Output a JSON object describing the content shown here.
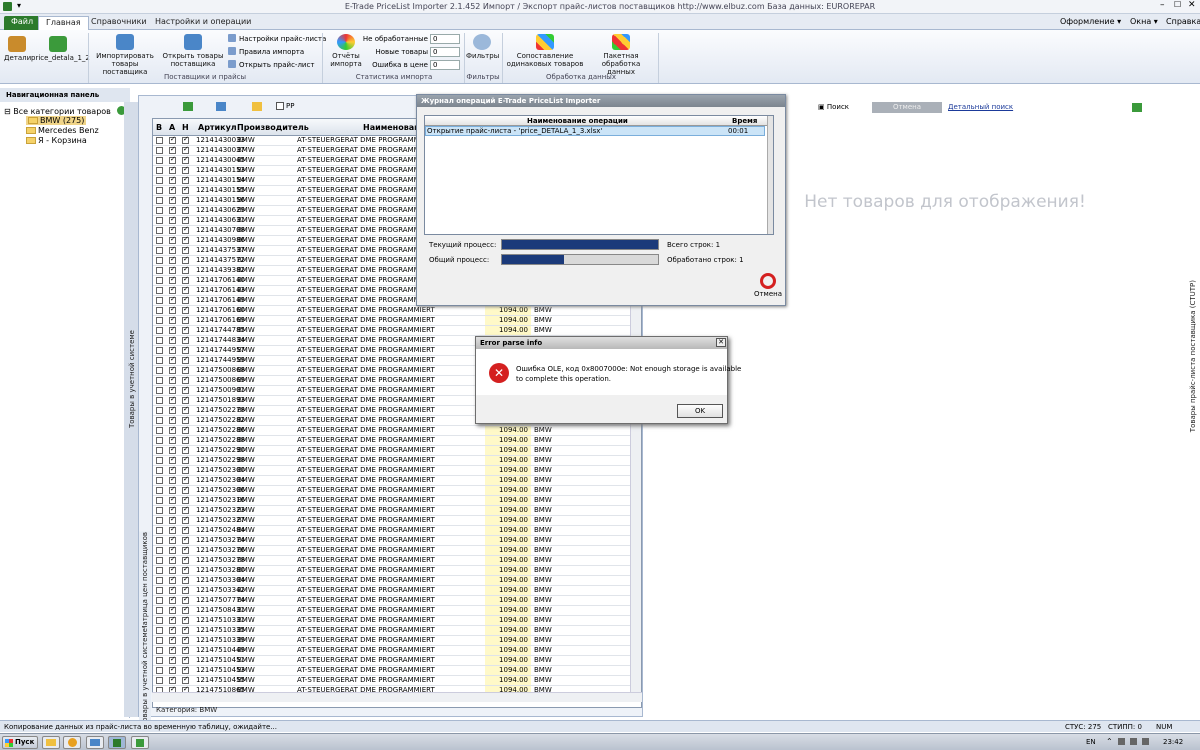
{
  "window": {
    "title": "E-Trade PriceList Importer 2.1.452     Импорт / Экспорт прайс-листов поставщиков     http://www.elbuz.com     База данных: EUROREPAR"
  },
  "tabs": {
    "file": "Файл",
    "main": "Главная",
    "refs": "Справочники",
    "settings": "Настройки и операции"
  },
  "top_right_menu": {
    "design": "Оформление",
    "windows": "Окна",
    "help": "Справка"
  },
  "ribbon": {
    "detail": "Детали",
    "price_detala": "price_detala_1_2",
    "import_goods": "Импортировать товары поставщика",
    "open_goods": "Открыть товары поставщика",
    "price_settings": "Настройки прайс-листа",
    "import_rules": "Правила импорта",
    "open_price": "Открыть прайс-лист",
    "group_suppliers": "Поставщики и прайсы",
    "import_reports": "Отчёты импорта",
    "stat_unprocessed_label": "Не обработанные",
    "stat_unprocessed_val": "0",
    "stat_new_label": "Новые товары",
    "stat_new_val": "0",
    "stat_error_label": "Ошибка в цене",
    "stat_error_val": "0",
    "group_stats": "Статистика импорта",
    "filters": "Фильтры",
    "group_filters": "Фильтры",
    "match_goods": "Сопоставление одинаковых товаров",
    "batch_processing": "Пакетная обработка данных",
    "group_processing": "Обработка данных"
  },
  "nav": {
    "title": "Навигационная панель",
    "all_categories": "Все категории товаров",
    "bmw": "BMW (275)",
    "mercedes": "Mercedes Benz",
    "cart": "Я - Корзина",
    "vertical_tab_accounting": "Товары в учетной системе",
    "vertical_tab_matrix": "Матрица цен поставщиков",
    "vertical_tab_goods": "Товары в учетной системе"
  },
  "grid": {
    "pp_label": "PP",
    "headers": [
      "В",
      "А",
      "Н",
      "Артикул",
      "Производитель",
      "Наименование"
    ],
    "name_value": "AT-STEUERGERAT DME PROGRAMMIERT",
    "manufacturer": "BMW",
    "price": "1094.00",
    "category_line": "Категория: BMW",
    "rows": [
      "12141430033",
      "12141430037",
      "12141430045",
      "12141430153",
      "12141430154",
      "12141430155",
      "12141430156",
      "12141430629",
      "12141430631",
      "12141430708",
      "12141430986",
      "12141437537",
      "12141437572",
      "12141439382",
      "12141706140",
      "12141706143",
      "12141706149",
      "12141706160",
      "12141706169",
      "12141744785",
      "12141744834",
      "12141744957",
      "12141744959",
      "12147500868",
      "12147500869",
      "12147500901",
      "12147501893",
      "12147502278",
      "12147502282",
      "12147502286",
      "12147502288",
      "12147502290",
      "12147502298",
      "12147502300",
      "12147502304",
      "12147502306",
      "12147502316",
      "12147502323",
      "12147502327",
      "12147502484",
      "12147503274",
      "12147503276",
      "12147503278",
      "12147503280",
      "12147503304",
      "12147503342",
      "12147507774",
      "12147508431",
      "12147510331",
      "12147510335",
      "12147510339",
      "12147510449",
      "12147510451",
      "12147510453",
      "12147510455",
      "12147510865"
    ]
  },
  "right_panel": {
    "search": "Поиск",
    "cancel": "Отмена",
    "detailed_search": "Детальный поиск",
    "no_goods": "Нет товаров для отображения!",
    "vertical_label": "Товары прайс-листа поставщика (CTUTP)"
  },
  "journal": {
    "title": "Журнал операций E-Trade PriceList Importer",
    "col_name": "Наименование операции",
    "col_time": "Время",
    "row_name": "Открытие прайс-листа - 'price_DETALA_1_3.xlsx'",
    "row_time": "00:01",
    "current_label": "Текущий процесс:",
    "total_label": "Общий процесс:",
    "current_progress": 1.0,
    "total_progress": 0.4,
    "total_rows": "Всего строк: 1",
    "processed_rows": "Обработано строк: 1",
    "cancel": "Отмена"
  },
  "error_dialog": {
    "title": "Error parse info",
    "message_line1": "Ошибка OLE, код 0x8007000e: Not enough storage is available",
    "message_line2": "to complete this operation.",
    "ok": "OK"
  },
  "status": {
    "message": "Копирование данных из прайс-листа во временную таблицу, ожидайте...",
    "stus": "СТУС: 275",
    "stipp": "СТИПП: 0",
    "num": "NUM"
  },
  "taskbar": {
    "start": "Пуск",
    "lang": "EN",
    "time": "23:42"
  },
  "colors": {
    "accent": "#1b3a7a",
    "file_tab": "#2c7a2c",
    "error": "#d42020"
  }
}
